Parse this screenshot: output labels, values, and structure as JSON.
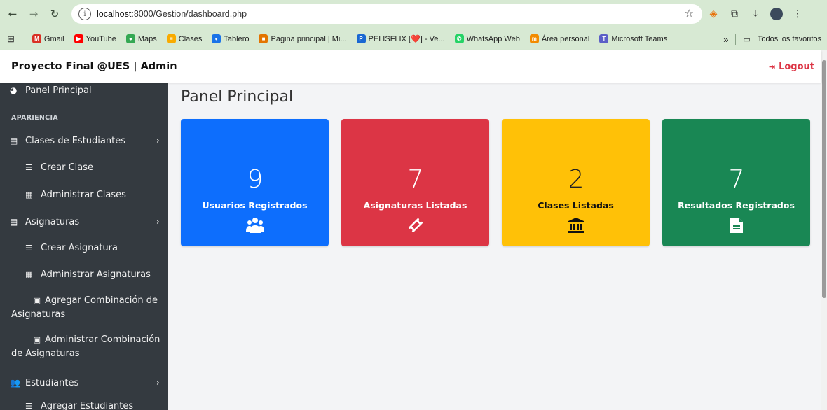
{
  "browser": {
    "url_host": "localhost",
    "url_path": ":8000/Gestion/dashboard.php",
    "bookmarks": [
      {
        "label": "Gmail",
        "color": "#d93025",
        "glyph": "M"
      },
      {
        "label": "YouTube",
        "color": "#ff0000",
        "glyph": "▶"
      },
      {
        "label": "Maps",
        "color": "#34a853",
        "glyph": "●"
      },
      {
        "label": "Clases",
        "color": "#f9ab00",
        "glyph": "≡"
      },
      {
        "label": "Tablero",
        "color": "#1a73e8",
        "glyph": "◐"
      },
      {
        "label": "Página principal | Mi...",
        "color": "#e37400",
        "glyph": "■"
      },
      {
        "label": "PELISFLIX [❤️] - Ve...",
        "color": "#1967d2",
        "glyph": "P"
      },
      {
        "label": "WhatsApp Web",
        "color": "#25d366",
        "glyph": "✆"
      },
      {
        "label": "Área personal",
        "color": "#f28b00",
        "glyph": "m"
      },
      {
        "label": "Microsoft Teams",
        "color": "#5b5fc7",
        "glyph": "T"
      }
    ],
    "overflow_label": "»",
    "all_bookmarks": "Todos los favoritos"
  },
  "header": {
    "brand": "Proyecto Final @UES | Admin",
    "logout": "Logout"
  },
  "sidebar": {
    "panel": "Panel Principal",
    "section_label": "APARIENCIA",
    "groups": [
      {
        "label": "Clases de Estudiantes"
      },
      {
        "label": "Asignaturas"
      },
      {
        "label": "Estudiantes"
      }
    ],
    "clases_sub": [
      "Crear Clase",
      "Administrar Clases"
    ],
    "asignaturas_sub": [
      "Crear Asignatura",
      "Administrar Asignaturas",
      "Agregar Combinación de Asignaturas",
      "Administrar Combinación de Asignaturas"
    ],
    "estudiantes_sub": [
      "Agregar Estudiantes"
    ]
  },
  "main": {
    "title": "Panel Principal",
    "cards": [
      {
        "value": "9",
        "label": "Usuarios Registrados",
        "color": "#0d6efd",
        "icon": "users-icon"
      },
      {
        "value": "7",
        "label": "Asignaturas Listadas",
        "color": "#dc3545",
        "icon": "ticket-icon"
      },
      {
        "value": "2",
        "label": "Clases Listadas",
        "color": "#ffc107",
        "icon": "bank-icon"
      },
      {
        "value": "7",
        "label": "Resultados Registrados",
        "color": "#198754",
        "icon": "file-text-icon"
      }
    ]
  }
}
